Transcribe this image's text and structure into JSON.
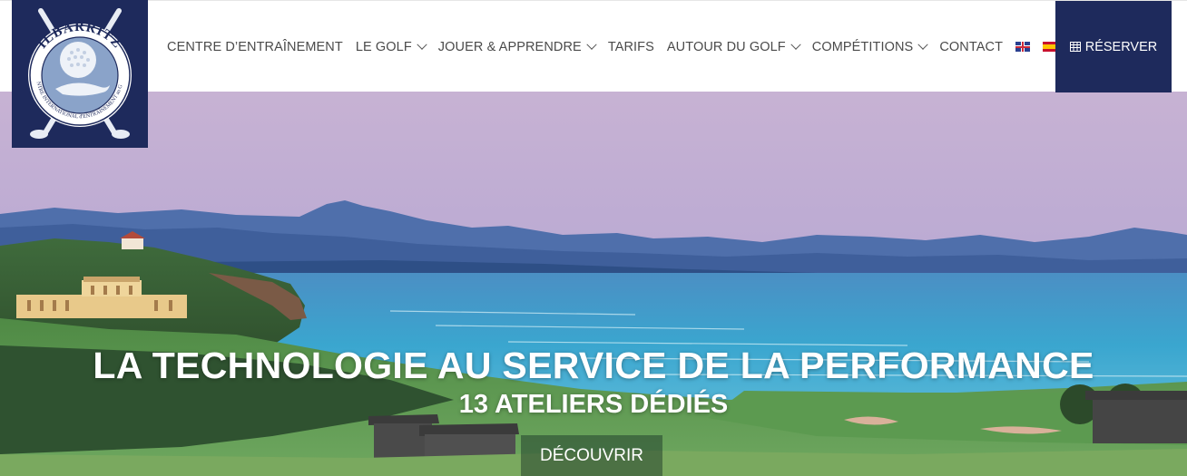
{
  "logo": {
    "alt": "Ilbarritz - Centre International d'Entraînement au Golf",
    "text_top": "ILBARRITZ",
    "text_ring": "CENTRE INTERNATIONAL d'ENTRAÎNEMENT au GOLF"
  },
  "nav": {
    "items": [
      {
        "label": "CENTRE D’ENTRAÎNEMENT",
        "dropdown": false
      },
      {
        "label": "LE GOLF",
        "dropdown": true
      },
      {
        "label": "JOUER & APPRENDRE",
        "dropdown": true
      },
      {
        "label": "TARIFS",
        "dropdown": false
      },
      {
        "label": "AUTOUR DU GOLF",
        "dropdown": true
      },
      {
        "label": "COMPÉTITIONS",
        "dropdown": true
      },
      {
        "label": "CONTACT",
        "dropdown": false
      }
    ],
    "languages": [
      "english-flag",
      "spanish-flag"
    ]
  },
  "reserve": {
    "label": "RÉSERVER",
    "icon": "calendar-icon"
  },
  "hero": {
    "title": "LA TECHNOLOGIE AU SERVICE DE LA PERFORMANCE",
    "subtitle": "13 ATELIERS DÉDIÉS",
    "button": "DÉCOUVRIR"
  },
  "colors": {
    "brand_navy": "#1e2a5c",
    "nav_text": "#4a4a4a",
    "sky_top": "#c9b7d6",
    "sea": "#3fa0c8"
  }
}
